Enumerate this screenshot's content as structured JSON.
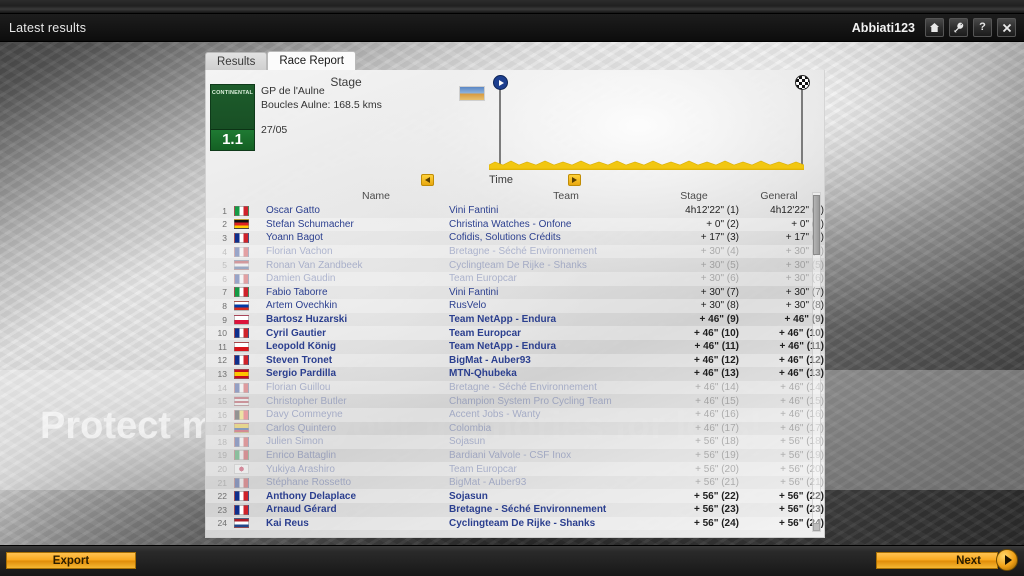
{
  "window": {
    "title": "Latest results",
    "user": "Abbiati123",
    "buttons": [
      {
        "name": "home-icon",
        "label": "⌂"
      },
      {
        "name": "wrench-icon",
        "label": "⚒"
      },
      {
        "name": "help-icon",
        "label": "?"
      },
      {
        "name": "close-icon",
        "label": "✕"
      }
    ]
  },
  "tabs": [
    {
      "label": "Results",
      "active": false
    },
    {
      "label": "Race Report",
      "active": true
    }
  ],
  "stage": {
    "heading": "Stage",
    "badge_category": "CONTINENTAL",
    "badge_class": "1.1",
    "race_name": "GP de l'Aulne",
    "race_distance": "Boucles Aulne: 168.5 kms",
    "race_date": "27/05"
  },
  "profile": {
    "start_marker": "start-play-icon",
    "finish_marker": "checkered-flag-icon",
    "thumbnail": "stage-thumbnail-image"
  },
  "time_nav": {
    "prev_label": "◀",
    "label": "Time",
    "next_label": "▶"
  },
  "table": {
    "headers": {
      "name": "Name",
      "team": "Team",
      "stage": "Stage",
      "general": "General"
    },
    "rows": [
      {
        "rank": "1",
        "flag": "italy",
        "name": "Oscar Gatto",
        "team": "Vini Fantini",
        "stage": "4h12'22\" (1)",
        "general": "4h12'22\" (1)",
        "style": "normal"
      },
      {
        "rank": "2",
        "flag": "germany",
        "name": "Stefan Schumacher",
        "team": "Christina Watches - Onfone",
        "stage": "+ 0\" (2)",
        "general": "+ 0\" (2)",
        "style": "normal"
      },
      {
        "rank": "3",
        "flag": "france",
        "name": "Yoann Bagot",
        "team": "Cofidis, Solutions Crédits",
        "stage": "+ 17\" (3)",
        "general": "+ 17\" (3)",
        "style": "normal"
      },
      {
        "rank": "4",
        "flag": "france",
        "name": "Florian Vachon",
        "team": "Bretagne - Séché Environnement",
        "stage": "+ 30\" (4)",
        "general": "+ 30\" (4)",
        "style": "dim"
      },
      {
        "rank": "5",
        "flag": "netherlands",
        "name": "Ronan Van Zandbeek",
        "team": "Cyclingteam De Rijke - Shanks",
        "stage": "+ 30\" (5)",
        "general": "+ 30\" (5)",
        "style": "dim"
      },
      {
        "rank": "6",
        "flag": "france",
        "name": "Damien Gaudin",
        "team": "Team Europcar",
        "stage": "+ 30\" (6)",
        "general": "+ 30\" (6)",
        "style": "dim"
      },
      {
        "rank": "7",
        "flag": "italy",
        "name": "Fabio Taborre",
        "team": "Vini Fantini",
        "stage": "+ 30\" (7)",
        "general": "+ 30\" (7)",
        "style": "normal"
      },
      {
        "rank": "8",
        "flag": "russia",
        "name": "Artem Ovechkin",
        "team": "RusVelo",
        "stage": "+ 30\" (8)",
        "general": "+ 30\" (8)",
        "style": "normal"
      },
      {
        "rank": "9",
        "flag": "poland",
        "name": "Bartosz Huzarski",
        "team": "Team NetApp - Endura",
        "stage": "+ 46\" (9)",
        "general": "+ 46\" (9)",
        "style": "bold"
      },
      {
        "rank": "10",
        "flag": "france",
        "name": "Cyril Gautier",
        "team": "Team Europcar",
        "stage": "+ 46\" (10)",
        "general": "+ 46\" (10)",
        "style": "bold"
      },
      {
        "rank": "11",
        "flag": "czech",
        "name": "Leopold König",
        "team": "Team NetApp - Endura",
        "stage": "+ 46\" (11)",
        "general": "+ 46\" (11)",
        "style": "bold"
      },
      {
        "rank": "12",
        "flag": "france",
        "name": "Steven Tronet",
        "team": "BigMat - Auber93",
        "stage": "+ 46\" (12)",
        "general": "+ 46\" (12)",
        "style": "bold"
      },
      {
        "rank": "13",
        "flag": "spain",
        "name": "Sergio Pardilla",
        "team": "MTN-Qhubeka",
        "stage": "+ 46\" (13)",
        "general": "+ 46\" (13)",
        "style": "bold"
      },
      {
        "rank": "14",
        "flag": "france",
        "name": "Florian Guillou",
        "team": "Bretagne - Séché Environnement",
        "stage": "+ 46\" (14)",
        "general": "+ 46\" (14)",
        "style": "dim"
      },
      {
        "rank": "15",
        "flag": "usa",
        "name": "Christopher Butler",
        "team": "Champion System Pro Cycling Team",
        "stage": "+ 46\" (15)",
        "general": "+ 46\" (15)",
        "style": "dim"
      },
      {
        "rank": "16",
        "flag": "belgium",
        "name": "Davy Commeyne",
        "team": "Accent Jobs - Wanty",
        "stage": "+ 46\" (16)",
        "general": "+ 46\" (16)",
        "style": "dim"
      },
      {
        "rank": "17",
        "flag": "colombia",
        "name": "Carlos Quintero",
        "team": "Colombia",
        "stage": "+ 46\" (17)",
        "general": "+ 46\" (17)",
        "style": "dim"
      },
      {
        "rank": "18",
        "flag": "france",
        "name": "Julien Simon",
        "team": "Sojasun",
        "stage": "+ 56\" (18)",
        "general": "+ 56\" (18)",
        "style": "dim"
      },
      {
        "rank": "19",
        "flag": "italy",
        "name": "Enrico Battaglin",
        "team": "Bardiani Valvole - CSF Inox",
        "stage": "+ 56\" (19)",
        "general": "+ 56\" (19)",
        "style": "dim"
      },
      {
        "rank": "20",
        "flag": "japan",
        "name": "Yukiya Arashiro",
        "team": "Team Europcar",
        "stage": "+ 56\" (20)",
        "general": "+ 56\" (20)",
        "style": "dim"
      },
      {
        "rank": "21",
        "flag": "france",
        "name": "Stéphane Rossetto",
        "team": "BigMat - Auber93",
        "stage": "+ 56\" (21)",
        "general": "+ 56\" (21)",
        "style": "dim"
      },
      {
        "rank": "22",
        "flag": "france",
        "name": "Anthony Delaplace",
        "team": "Sojasun",
        "stage": "+ 56\" (22)",
        "general": "+ 56\" (22)",
        "style": "bold"
      },
      {
        "rank": "23",
        "flag": "france",
        "name": "Arnaud Gérard",
        "team": "Bretagne - Séché Environnement",
        "stage": "+ 56\" (23)",
        "general": "+ 56\" (23)",
        "style": "bold"
      },
      {
        "rank": "24",
        "flag": "netherlands",
        "name": "Kai Reus",
        "team": "Cyclingteam De Rijke - Shanks",
        "stage": "+ 56\" (24)",
        "general": "+ 56\" (24)",
        "style": "bold"
      }
    ]
  },
  "footer": {
    "export_label": "Export",
    "next_label": "Next"
  },
  "watermark": {
    "line1": "Protect more of your memories for less!"
  },
  "colors": {
    "accent_orange": "#f9a81e",
    "link_blue": "#2b3f8f",
    "badge_green": "#1d5c2b",
    "terrain_yellow": "#f2c711"
  }
}
